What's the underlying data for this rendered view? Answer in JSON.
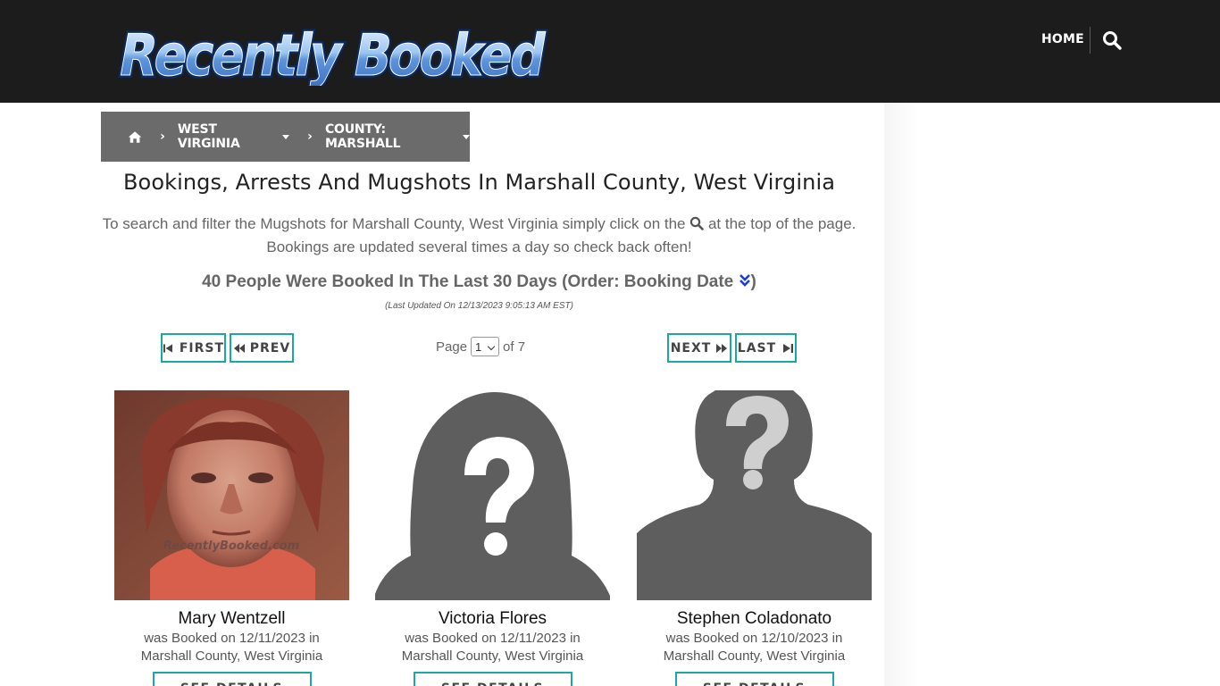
{
  "header": {
    "logo_text": "Recently Booked",
    "nav": {
      "home_label": "HOME",
      "search_icon": "search-icon"
    }
  },
  "breadcrumb": {
    "home_icon": "home-icon",
    "state_label": "WEST VIRGINIA",
    "county_label": "COUNTY: MARSHALL"
  },
  "main": {
    "title": "Bookings, Arrests And Mugshots In Marshall County, West Virginia",
    "intro_before_icon": "To search and filter the Mugshots for Marshall County, West Virginia simply click on the",
    "intro_after_icon": "at the top of the page.",
    "intro_line2": "Bookings are updated several times a day so check back often!",
    "count_text": "40 People Were Booked In The Last 30 Days (Order: Booking Date",
    "count_close": ")",
    "updated_text": "(Last Updated On 12/13/2023 9:05:13 AM EST)"
  },
  "pagination": {
    "first_label": "FIRST",
    "prev_label": "PREV",
    "next_label": "NEXT",
    "last_label": "LAST",
    "page_prefix": "Page",
    "current_page": "1",
    "page_suffix": "of 7"
  },
  "colors": {
    "header_bg": "#1c1c1c",
    "breadcrumb_bg": "#6b6b6b",
    "accent_teal": "#1aa8a0",
    "order_icon": "#1a3fd6"
  },
  "bookings": [
    {
      "name": "Mary Wentzell",
      "line1": "was Booked on 12/11/2023 in",
      "line2": "Marshall County, West Virginia",
      "photo_watermark": "RecentlyBooked.com",
      "details_label": "SEE DETAILS"
    },
    {
      "name": "Victoria Flores",
      "line1": "was Booked on 12/11/2023 in",
      "line2": "Marshall County, West Virginia",
      "details_label": "SEE DETAILS"
    },
    {
      "name": "Stephen Coladonato",
      "line1": "was Booked on 12/10/2023 in",
      "line2": "Marshall County, West Virginia",
      "details_label": "SEE DETAILS"
    }
  ]
}
